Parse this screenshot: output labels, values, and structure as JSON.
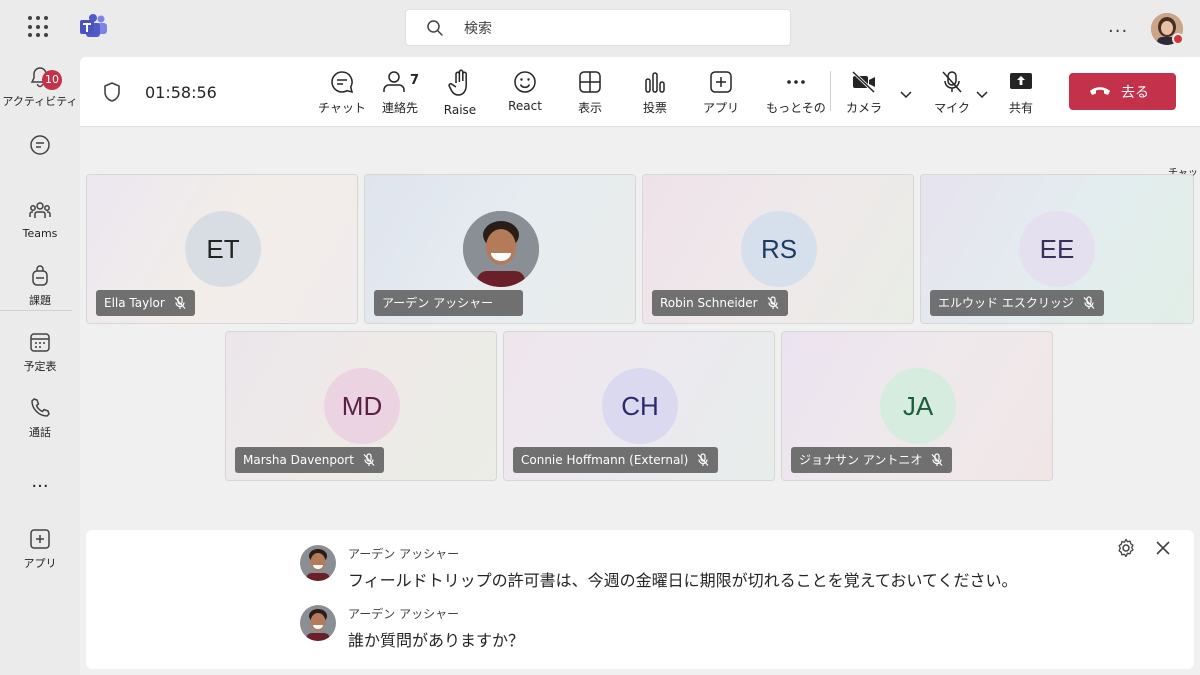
{
  "topbar": {
    "apps_icon": "waffle-icon",
    "logo_icon": "teams-logo-icon",
    "search_placeholder": "検索",
    "more_label": "...",
    "avatar_icon": "user-avatar",
    "presence": "busy",
    "presence_color": "#d13438"
  },
  "rail": {
    "items": [
      {
        "label": "アクティビティ",
        "icon": "bell-icon",
        "badge": "10"
      },
      {
        "label": "",
        "icon": "chat-bubble-icon"
      },
      {
        "label": "Teams",
        "icon": "teams-people-icon"
      },
      {
        "label": "課題",
        "icon": "backpack-icon"
      },
      {
        "label": "予定表",
        "icon": "calendar-icon"
      },
      {
        "label": "通話",
        "icon": "phone-icon"
      },
      {
        "label": "...",
        "icon": "more-icon"
      },
      {
        "label": "アプリ",
        "icon": "add-app-icon"
      }
    ]
  },
  "callbar": {
    "timer": "01:58:56",
    "controls": [
      {
        "label": "チャット",
        "icon": "chat-icon"
      },
      {
        "label": "連絡先",
        "icon": "people-icon",
        "count": "7"
      },
      {
        "label": "Raise",
        "icon": "raise-hand-icon"
      },
      {
        "label": "React",
        "icon": "emoji-icon"
      },
      {
        "label": "表示",
        "icon": "grid-view-icon"
      },
      {
        "label": "投票",
        "icon": "poll-icon"
      },
      {
        "label": "アプリ",
        "icon": "add-app-icon"
      },
      {
        "label": "もっとその",
        "icon": "more-icon"
      },
      {
        "label": "カメラ",
        "icon": "camera-off-icon"
      },
      {
        "label": "マイク",
        "icon": "mic-off-icon"
      },
      {
        "label": "共有",
        "icon": "share-screen-icon"
      }
    ],
    "leave_label": "去る",
    "leave_color": "#c4314b",
    "chat_float_label": "チャット"
  },
  "participants": [
    {
      "initials": "ET",
      "name": "Ella Taylor",
      "avatar_bg": "#d7dde3",
      "avatar_fg": "#242424",
      "muted": true
    },
    {
      "initials": "",
      "name": "アーデン アッシャー",
      "avatar_bg": "#9a6b52",
      "avatar_fg": "#ffffff",
      "muted": false,
      "photo": true
    },
    {
      "initials": "RS",
      "name": "Robin Schneider",
      "avatar_bg": "#d6e0ec",
      "avatar_fg": "#1f3a5f",
      "muted": true
    },
    {
      "initials": "EE",
      "name": "エルウッド エスクリッジ",
      "avatar_bg": "#e4e0ef",
      "avatar_fg": "#3b2f5c",
      "muted": true
    },
    {
      "initials": "MD",
      "name": "Marsha Davenport",
      "avatar_bg": "#ecd3e2",
      "avatar_fg": "#5c1f45",
      "muted": true
    },
    {
      "initials": "CH",
      "name": "Connie Hoffmann (External)",
      "avatar_bg": "#dad9ef",
      "avatar_fg": "#2d2a6b",
      "muted": true
    },
    {
      "initials": "JA",
      "name": "ジョナサン アントニオ",
      "avatar_bg": "#d6ecdf",
      "avatar_fg": "#1b5e3a",
      "muted": true
    }
  ],
  "chat": {
    "messages": [
      {
        "sender": "アーデン アッシャー",
        "text": "フィールドトリップの許可書は、今週の金曜日に期限が切れることを覚えておいてください。"
      },
      {
        "sender": "アーデン アッシャー",
        "text": "誰か質問がありますか？"
      }
    ]
  }
}
